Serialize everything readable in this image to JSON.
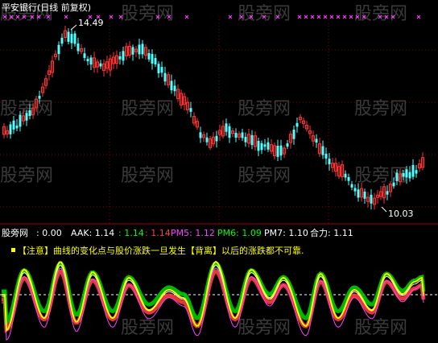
{
  "chart_data": [
    {
      "type": "candlestick",
      "title": "平安银行(日线 前复权)",
      "annotations": [
        {
          "label": "14.49",
          "kind": "high"
        },
        {
          "label": "10.03",
          "kind": "low"
        }
      ],
      "ylim": [
        9.6,
        15.0
      ],
      "grid": true,
      "colors": {
        "up": "#ff3232",
        "down": "#54ffff",
        "marker": "#ff40ff",
        "watermark": "#3a3a3a"
      },
      "watermark": "股旁网"
    },
    {
      "type": "line",
      "header": {
        "name": "股旁网",
        "value0": ": 0.00",
        "items": [
          {
            "text": "AAK: 1.14",
            "color": "#ffffff"
          },
          {
            "text": ": 1.14",
            "color": "#00ff00"
          },
          {
            "text": ": 1.14",
            "color": "#ff3c3c"
          },
          {
            "text": "PM5: 1.12",
            "color": "#ff40ff"
          },
          {
            "text": "PM6: 1.09",
            "color": "#00ff00"
          },
          {
            "text": "PM7: 1.10",
            "color": "#ffffff"
          },
          {
            "text": "合力: 1.11",
            "color": "#ffffff"
          }
        ]
      },
      "note": "【注意】曲线的变化点与股价涨跌一旦发生【背离】以后的涨跌都不可靠.",
      "series": [
        {
          "name": "AAK",
          "color": "#ffffff"
        },
        {
          "name": "PM5",
          "color": "#ff40ff"
        },
        {
          "name": "PM6",
          "color": "#00ff00"
        },
        {
          "name": "PM7",
          "color": "#ffffff"
        },
        {
          "name": "合力",
          "color": "#ffff00"
        }
      ],
      "ylim": [
        0.9,
        1.25
      ]
    }
  ]
}
